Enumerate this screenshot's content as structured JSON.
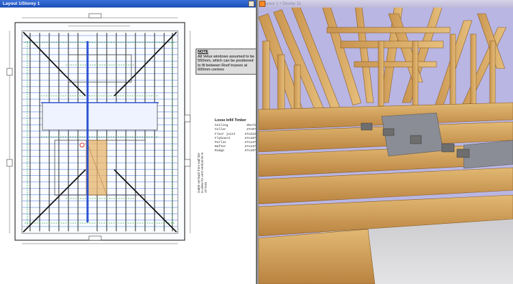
{
  "plan_window": {
    "title": "Layout 1/Storey 1",
    "note": {
      "heading": "NOTE",
      "text": "All Velux windows assumed to be 550mm, which can be positioned to fit between Roof trusses at 600mm centres"
    },
    "loose_infill": {
      "title": "Loose Infill Timber",
      "rows": [
        {
          "name": "Ceiling",
          "size": "35x72"
        },
        {
          "name": "Collar",
          "size": "47x97"
        },
        {
          "name": "Floor joist",
          "size": "47x222"
        },
        {
          "name": "Flyboard",
          "size": "47x197"
        },
        {
          "name": "Purlin",
          "size": "47x147"
        },
        {
          "name": "Rafter",
          "size": "47x147"
        },
        {
          "name": "Ridge",
          "size": "47x197"
        }
      ]
    },
    "gable_note": "Gable set back from wall line to allow for vent vertical tie to 19 truss",
    "colors": {
      "title_bar": "#1c4fb8",
      "framing": "#1a1a1a",
      "blue_lines": "#3f6ce0",
      "green_dashes": "#33a845",
      "orange_fill": "#e8b46a"
    }
  },
  "view3d_window": {
    "title": "Layout 1 • Storey 11",
    "colors": {
      "sky": "#b9b6e3",
      "timber": "#d6a860",
      "timber_dark": "#9c6b2c"
    }
  }
}
